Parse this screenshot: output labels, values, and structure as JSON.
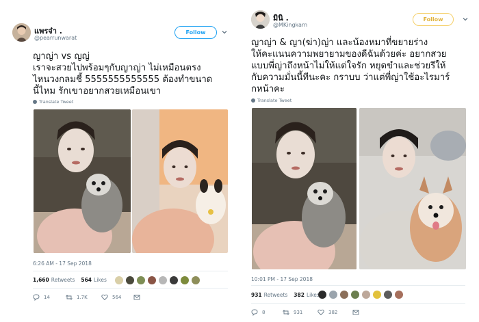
{
  "tweets": [
    {
      "display_name": "แพรจ๋า .",
      "handle": "@pearrunwarat",
      "follow_label": "Follow",
      "text_lines": [
        "ญาญ่า vs ญญ่",
        "เราจะสวยไปพร้อมๆกับญาญ่า ไม่เหมือนตรง",
        "ไหนวงกลมชี้ 5555555555555 ต้องทำขนาด",
        "นี้ไหม รักเขาอยากสวยเหมือนเขา"
      ],
      "translate_label": "Translate Tweet",
      "timestamp": "6:26 AM - 17 Sep 2018",
      "retweets_count": "1,660",
      "retweets_label": "Retweets",
      "likes_count": "564",
      "likes_label": "Likes",
      "reply_count": "14",
      "retweet_action_count": "1.7K",
      "like_action_count": "564",
      "liker_colors": [
        "#d9cfa8",
        "#4a4a3c",
        "#7e8e55",
        "#8a5546",
        "#b7b7b7",
        "#3a3a3a",
        "#7d8b3c",
        "#8e8e5a"
      ]
    },
    {
      "display_name": "มินิ .",
      "handle": "@MKingkarn",
      "follow_label": "Follow",
      "text_lines": [
        "ญาญ่า & ญา(ฆ่า)ญ่า และน้องหมาที่ขยายร่าง",
        "ให้คะแนนความพยายามของดีฉันด้วยค่ะ อยากสวย",
        "แบบพี่ญ่าถึงหน้าไม่ให้แต่ใจรัก หยุดขำและช่วยรีให้",
        "กับความมั่นนี้ทีนะคะ กราบบ ว่าแต่พี่ญ่าใช้อะไรมาร์",
        "กหน้าคะ"
      ],
      "translate_label": "Translate Tweet",
      "timestamp": "10:01 PM - 17 Sep 2018",
      "retweets_count": "931",
      "retweets_label": "Retweets",
      "likes_count": "382",
      "likes_label": "Likes",
      "reply_count": "8",
      "retweet_action_count": "931",
      "like_action_count": "382",
      "liker_colors": [
        "#2b2b2b",
        "#9aa4ad",
        "#8b6f5a",
        "#6c7f4f",
        "#bda89a",
        "#e2c23c",
        "#5c5c5c",
        "#a6705d"
      ]
    }
  ],
  "colors": {
    "link_blue": "#1da1f2",
    "muted": "#657786",
    "follow_yellow_border": "#f5d06a",
    "divider": "#e6ecf0"
  },
  "icons": [
    "reply-icon",
    "retweet-icon",
    "like-icon",
    "message-icon",
    "chevron-down-icon",
    "globe-icon"
  ]
}
